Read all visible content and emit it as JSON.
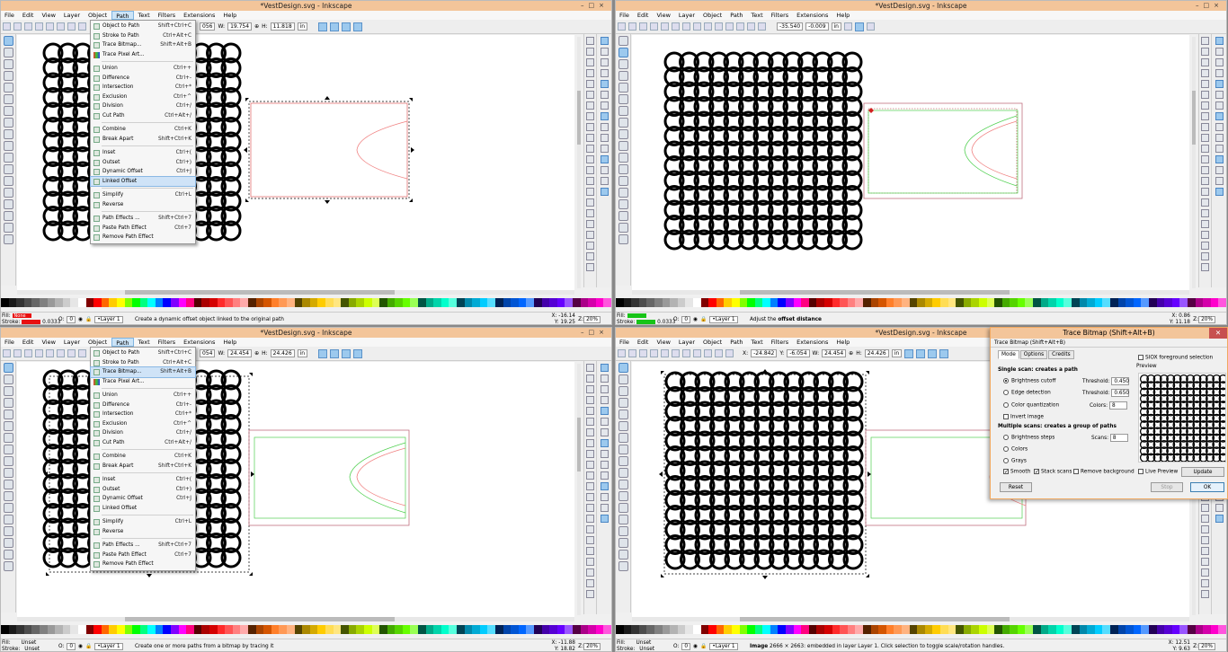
{
  "app": {
    "window_title": "*VestDesign.svg - Inkscape",
    "window_controls": [
      "–",
      "□",
      "×"
    ]
  },
  "menubar": [
    "File",
    "Edit",
    "View",
    "Layer",
    "Object",
    "Path",
    "Text",
    "Filters",
    "Extensions",
    "Help"
  ],
  "path_menu": [
    {
      "label": "Object to Path",
      "shortcut": "Shift+Ctrl+C"
    },
    {
      "label": "Stroke to Path",
      "shortcut": "Ctrl+Alt+C"
    },
    {
      "label": "Trace Bitmap...",
      "shortcut": "Shift+Alt+B"
    },
    {
      "label": "Trace Pixel Art...",
      "shortcut": ""
    },
    {
      "label": "Union",
      "shortcut": "Ctrl++"
    },
    {
      "label": "Difference",
      "shortcut": "Ctrl+-"
    },
    {
      "label": "Intersection",
      "shortcut": "Ctrl+*"
    },
    {
      "label": "Exclusion",
      "shortcut": "Ctrl+^"
    },
    {
      "label": "Division",
      "shortcut": "Ctrl+/"
    },
    {
      "label": "Cut Path",
      "shortcut": "Ctrl+Alt+/"
    },
    {
      "label": "Combine",
      "shortcut": "Ctrl+K"
    },
    {
      "label": "Break Apart",
      "shortcut": "Shift+Ctrl+K"
    },
    {
      "label": "Inset",
      "shortcut": "Ctrl+("
    },
    {
      "label": "Outset",
      "shortcut": "Ctrl+)"
    },
    {
      "label": "Dynamic Offset",
      "shortcut": "Ctrl+J"
    },
    {
      "label": "Linked Offset",
      "shortcut": ""
    },
    {
      "label": "Simplify",
      "shortcut": "Ctrl+L"
    },
    {
      "label": "Reverse",
      "shortcut": ""
    },
    {
      "label": "Path Effects ...",
      "shortcut": "Shift+Ctrl+7"
    },
    {
      "label": "Paste Path Effect",
      "shortcut": "Ctrl+7"
    },
    {
      "label": "Remove Path Effect",
      "shortcut": ""
    }
  ],
  "quadrants": [
    {
      "highlighted_item": "Linked Offset",
      "toolbar": {
        "x": "056",
        "w_label": "W:",
        "w": "19.754",
        "h_label": "H:",
        "h": "11.818",
        "unit": "in"
      },
      "status": {
        "fill_label": "Fill:",
        "stroke_label": "Stroke:",
        "fill": "None",
        "fill_color": "#e81010",
        "stroke": "0.0333",
        "opacity": "0",
        "layer": "•Layer 1",
        "message_plain": "Create a dynamic offset object linked to the original path",
        "message_bold": "",
        "message_tail": "",
        "x_readout": "X: -16.14",
        "y_readout": "Y: 19.25",
        "zoom": "20%"
      }
    },
    {
      "toolbar": {
        "x": "-35.540",
        "y": "-0.009",
        "unit": "in"
      },
      "status": {
        "fill_label": "Fill:",
        "stroke_label": "Stroke:",
        "fill": "",
        "fill_color": "#18c418",
        "stroke": "0.0333",
        "opacity": "0",
        "layer": "•Layer 1",
        "message_plain": "Adjust the ",
        "message_bold": "offset distance",
        "message_tail": "",
        "x_readout": "X: 0.86",
        "y_readout": "Y: 11.18",
        "zoom": "20%"
      }
    },
    {
      "highlighted_item": "Trace Bitmap...",
      "toolbar": {
        "x": "054",
        "w_label": "W:",
        "w": "24.454",
        "h_label": "H:",
        "h": "24.426",
        "unit": "in"
      },
      "status": {
        "fill_label": "Fill:",
        "stroke_label": "Stroke:",
        "fill": "Unset",
        "fill_color": "",
        "stroke": "Unset",
        "opacity": "0",
        "layer": "•Layer 1",
        "message_plain": "Create one or more paths from a bitmap by tracing it",
        "message_bold": "",
        "message_tail": "",
        "x_readout": "X: -11.88",
        "y_readout": "Y: 18.82",
        "zoom": "20%"
      }
    },
    {
      "toolbar": {
        "x_label": "X:",
        "x": "-24.842",
        "y_label": "Y:",
        "y": "-6.054",
        "w_label": "W:",
        "w": "24.454",
        "h_label": "H:",
        "h": "24.426",
        "unit": "in"
      },
      "status": {
        "fill_label": "Fill:",
        "stroke_label": "Stroke:",
        "fill": "Unset",
        "fill_color": "",
        "stroke": "Unset",
        "opacity": "0",
        "layer": "•Layer 1",
        "message_plain": "",
        "message_bold": "Image",
        "message_tail": " 2666 × 2663: embedded in layer Layer 1. Click selection to toggle scale/rotation handles.",
        "x_readout": "X: 12.51",
        "y_readout": "Y: 9.63",
        "zoom": "20%"
      }
    }
  ],
  "trace_dialog": {
    "window_title": "Trace Bitmap (Shift+Alt+B)",
    "subtitle": "Trace Bitmap (Shift+Alt+B)",
    "tabs": [
      "Mode",
      "Options",
      "Credits"
    ],
    "single_scan_heading": "Single scan: creates a path",
    "brightness_cutoff": "Brightness cutoff",
    "edge_detection": "Edge detection",
    "color_quantization": "Color quantization",
    "invert_image": "Invert image",
    "threshold_label": "Threshold:",
    "threshold_1": "0.450",
    "threshold_2": "0.650",
    "colors_label": "Colors:",
    "colors_value": "8",
    "multi_scan_heading": "Multiple scans: creates a group of paths",
    "brightness_steps": "Brightness steps",
    "scans_label": "Scans:",
    "scans_value": "8",
    "colors_option": "Colors",
    "grays_option": "Grays",
    "smooth": "Smooth",
    "stack_scans": "Stack scans",
    "remove_background": "Remove background",
    "siox": "SIOX foreground selection",
    "preview_label": "Preview",
    "live_preview": "Live Preview",
    "update": "Update",
    "reset": "Reset",
    "stop": "Stop",
    "ok": "OK"
  },
  "palette_colors": [
    "#000000",
    "#1a1a1a",
    "#333333",
    "#4d4d4d",
    "#666666",
    "#808080",
    "#999999",
    "#b3b3b3",
    "#cccccc",
    "#e6e6e6",
    "#ffffff",
    "#800000",
    "#ff0000",
    "#ff6600",
    "#ffcc00",
    "#ffff00",
    "#80ff00",
    "#00ff00",
    "#00ff80",
    "#00ffff",
    "#0080ff",
    "#0000ff",
    "#8000ff",
    "#ff00ff",
    "#ff0080",
    "#550000",
    "#aa0000",
    "#d40000",
    "#ff2a2a",
    "#ff5555",
    "#ff8080",
    "#ffaaaa",
    "#552200",
    "#aa4400",
    "#d45500",
    "#ff7f2a",
    "#ff9955",
    "#ffb380",
    "#554400",
    "#aa8800",
    "#d4aa00",
    "#ffcc00",
    "#ffdd55",
    "#ffe680",
    "#445500",
    "#88aa00",
    "#aad400",
    "#ccff00",
    "#ddff55",
    "#225500",
    "#44aa00",
    "#55d400",
    "#66ff00",
    "#99ff55",
    "#005544",
    "#00aa88",
    "#00d4aa",
    "#00ffcc",
    "#55ffdd",
    "#004455",
    "#0088aa",
    "#00aad4",
    "#00ccff",
    "#55ddff",
    "#002255",
    "#0044aa",
    "#0055d4",
    "#0066ff",
    "#5599ff",
    "#220055",
    "#4400aa",
    "#5500d4",
    "#6600ff",
    "#9955ff",
    "#550044",
    "#aa0088",
    "#d400aa",
    "#ff00cc",
    "#ff55dd"
  ]
}
